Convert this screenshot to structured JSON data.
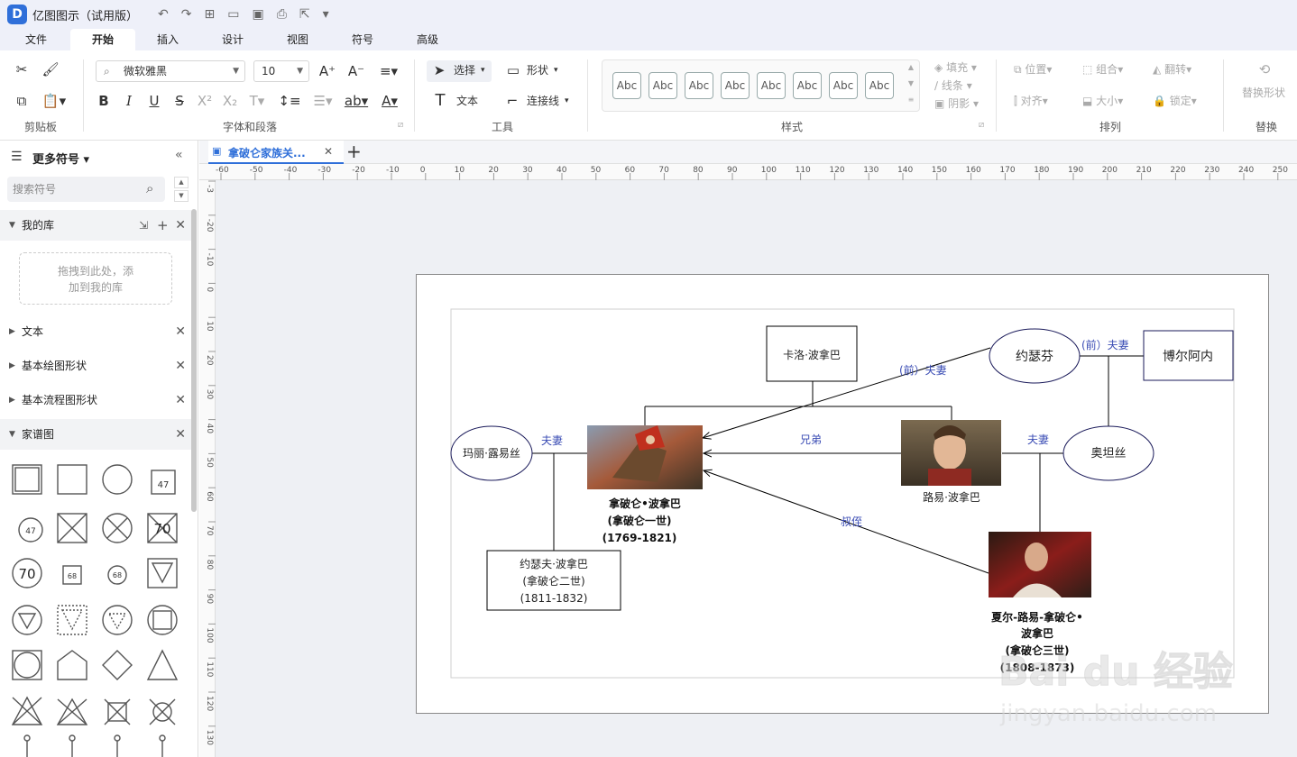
{
  "app": {
    "title": "亿图图示（试用版）",
    "logo_letter": "D"
  },
  "menu": {
    "tabs": [
      "文件",
      "开始",
      "插入",
      "设计",
      "视图",
      "符号",
      "高级"
    ],
    "active": "开始"
  },
  "ribbon": {
    "groups": {
      "clipboard": "剪贴板",
      "font": "字体和段落",
      "tools": "工具",
      "styles": "样式",
      "arrange": "排列",
      "replace": "替换"
    },
    "font_family": "微软雅黑",
    "font_size": "10",
    "select_label": "选择",
    "shape_label": "形状",
    "text_label": "文本",
    "connector_label": "连接线",
    "style_sample": "Abc",
    "fill_label": "填充",
    "line_label": "线条",
    "shadow_label": "阴影",
    "position_label": "位置",
    "group_label": "组合",
    "flip_label": "翻转",
    "align_label": "对齐",
    "size_label": "大小",
    "lock_label": "锁定",
    "replace_shape_label": "替换形状"
  },
  "library": {
    "title": "更多符号",
    "search_placeholder": "搜索符号",
    "my_lib": "我的库",
    "drop_hint_1": "拖拽到此处，添",
    "drop_hint_2": "加到我的库",
    "sections": [
      "文本",
      "基本绘图形状",
      "基本流程图形状",
      "家谱图"
    ]
  },
  "document": {
    "tab_title": "拿破仑家族关..."
  },
  "rulers": {
    "h": [
      "-60",
      "-50",
      "-40",
      "-30",
      "-20",
      "-10",
      "0",
      "10",
      "20",
      "30",
      "40",
      "50",
      "60",
      "70",
      "80",
      "90",
      "100",
      "110",
      "120",
      "130",
      "140",
      "150",
      "160",
      "170",
      "180",
      "190",
      "200",
      "210",
      "220",
      "230",
      "240",
      "250"
    ],
    "v": [
      "-3",
      "-20",
      "-10",
      "0",
      "10",
      "20",
      "30",
      "40",
      "50",
      "60",
      "70",
      "80",
      "90",
      "100",
      "110",
      "120",
      "130"
    ]
  },
  "diagram": {
    "carlo": "卡洛·波拿巴",
    "josephine": "约瑟芬",
    "beauharnais": "博尔阿内",
    "marie_louise": "玛丽·露易丝",
    "hortense": "奥坦丝",
    "napoleon1": [
      "拿破仑•波拿巴",
      "(拿破仑一世)",
      "(1769-1821)"
    ],
    "louis": "路易·波拿巴",
    "napoleon2": [
      "约瑟夫·波拿巴",
      "(拿破仑二世)",
      "(1811-1832)"
    ],
    "napoleon3": [
      "夏尔-路易-拿破仑•",
      "波拿巴",
      "(拿破仑三世)",
      "(1808-1873)"
    ],
    "edges": {
      "ex_spouse_1": "(前）夫妻",
      "ex_spouse_2": "(前）夫妻",
      "spouse_1": "夫妻",
      "brothers": "兄弟",
      "spouse_2": "夫妻",
      "nephew": "叔侄"
    }
  },
  "watermark": {
    "brand": "Bai du 经验",
    "url": "jingyan.baidu.com"
  }
}
